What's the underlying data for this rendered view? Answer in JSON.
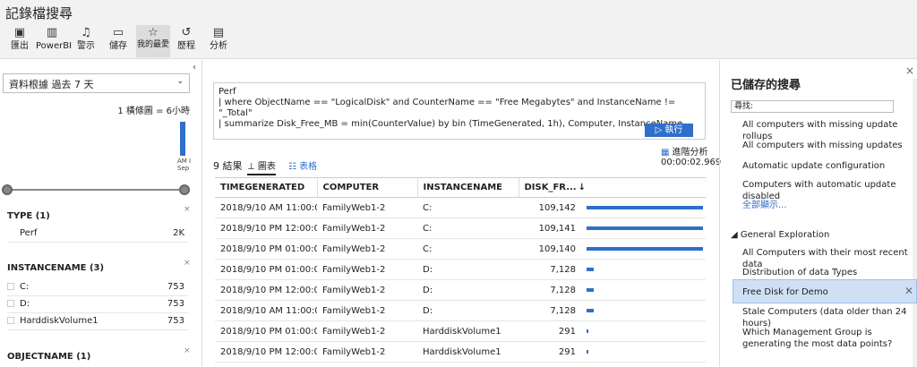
{
  "app": {
    "title": "記錄檔搜尋"
  },
  "toolbar": [
    {
      "icon": "excel-icon",
      "glyph": "▣",
      "label": "匯出"
    },
    {
      "icon": "powerbi-icon",
      "glyph": "▥",
      "label": "PowerBI"
    },
    {
      "icon": "bell-icon",
      "glyph": "♫",
      "label": "警示"
    },
    {
      "icon": "save-icon",
      "glyph": "▭",
      "label": "儲存"
    },
    {
      "icon": "star-icon",
      "glyph": "☆",
      "label": "我的最愛"
    },
    {
      "icon": "history-icon",
      "glyph": "↺",
      "label": "歷程"
    },
    {
      "icon": "analytics-icon",
      "glyph": "▤",
      "label": "分析"
    }
  ],
  "left": {
    "collapse": "‹",
    "range_label": "資料根據 過去 7 天",
    "bar_note": "1 橫條圖 = 6小時",
    "hist_label": "AM I Sep",
    "facets": [
      {
        "title": "TYPE (1)",
        "rows": [
          {
            "name": "Perf",
            "count": "2K"
          }
        ]
      },
      {
        "title": "INSTANCENAME (3)",
        "rows": [
          {
            "name": "C:",
            "count": "753"
          },
          {
            "name": "D:",
            "count": "753"
          },
          {
            "name": "HarddiskVolume1",
            "count": "753"
          }
        ]
      },
      {
        "title": "OBJECTNAME (1)",
        "rows": []
      }
    ]
  },
  "query": {
    "line1": "Perf",
    "line2": "| where ObjectName == \"LogicalDisk\" and CounterName == \"Free Megabytes\" and InstanceName != \"_Total\"",
    "line3": "| summarize Disk_Free_MB = min(CounterValue) by bin (TimeGenerated, 1h), Computer, InstanceName",
    "run_label": "▷ 執行",
    "advanced_label": "進階分析",
    "elapsed": "00:00:02.969"
  },
  "results": {
    "count": "9 結果",
    "tab_chart": "圖表",
    "tab_table": "表格",
    "columns": [
      "TIMEGENERATED",
      "COMPUTER",
      "INSTANCENAME",
      "DISK_FR..."
    ],
    "rows": [
      {
        "time": "2018/9/10 AM 11:00:00.00",
        "computer": "FamilyWeb1-2",
        "instance": "C:",
        "value": "109,142",
        "fraction": 1.0
      },
      {
        "time": "2018/9/10 PM 12:00:00.00",
        "computer": "FamilyWeb1-2",
        "instance": "C:",
        "value": "109,141",
        "fraction": 1.0
      },
      {
        "time": "2018/9/10 PM 01:00:00.00",
        "computer": "FamilyWeb1-2",
        "instance": "C:",
        "value": "109,140",
        "fraction": 1.0
      },
      {
        "time": "2018/9/10 PM 01:00:00.00",
        "computer": "FamilyWeb1-2",
        "instance": "D:",
        "value": "7,128",
        "fraction": 0.065
      },
      {
        "time": "2018/9/10 PM 12:00:00.00",
        "computer": "FamilyWeb1-2",
        "instance": "D:",
        "value": "7,128",
        "fraction": 0.065
      },
      {
        "time": "2018/9/10 AM 11:00:00.00",
        "computer": "FamilyWeb1-2",
        "instance": "D:",
        "value": "7,128",
        "fraction": 0.065
      },
      {
        "time": "2018/9/10 PM 01:00:00.00",
        "computer": "FamilyWeb1-2",
        "instance": "HarddiskVolume1",
        "value": "291",
        "fraction": 0.003
      },
      {
        "time": "2018/9/10 PM 12:00:00.00",
        "computer": "FamilyWeb1-2",
        "instance": "HarddiskVolume1",
        "value": "291",
        "fraction": 0.003
      },
      {
        "time": "2018/9/10 AM 11:00:00.00",
        "computer": "FamilyWeb1-2",
        "instance": "HarddiskVolume1",
        "value": "291",
        "fraction": 0.003
      }
    ]
  },
  "saved": {
    "title": "已儲存的搜尋",
    "search_placeholder": "尋找:",
    "items": [
      "All computers with missing update rollups",
      "All computers with missing updates",
      "Automatic update configuration",
      "Computers with automatic update disabled"
    ],
    "show_all": "全部顯示...",
    "group": "General Exploration",
    "group_items": [
      "All Computers with their most recent data",
      "Distribution of data Types",
      "Free Disk for Demo",
      "Stale Computers (data older than 24 hours)",
      "Which Management Group is generating the most data points?"
    ],
    "selected": "Free Disk for Demo"
  },
  "colors": {
    "accent": "#2f6fca",
    "selected_bg": "#cfe0f5"
  }
}
